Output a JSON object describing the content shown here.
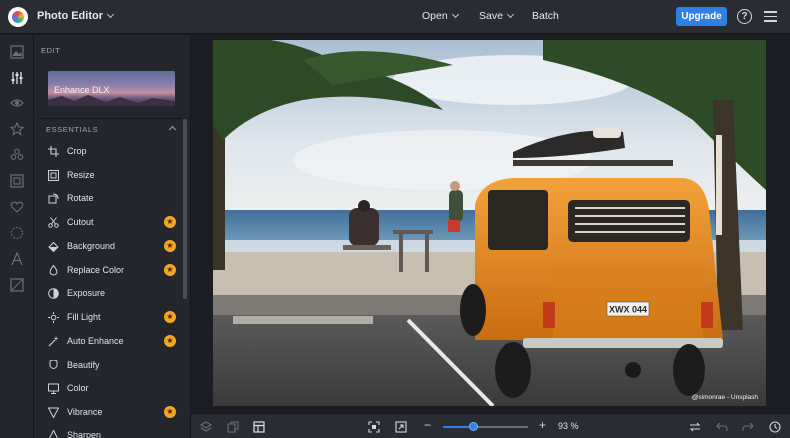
{
  "header": {
    "app_menu": "Photo Editor",
    "nav": [
      "Open",
      "Save",
      "Batch"
    ],
    "upgrade": "Upgrade",
    "help_glyph": "?"
  },
  "rail": {
    "icons": [
      "image-icon",
      "sliders-icon",
      "eye-icon",
      "star-icon",
      "brush-icon",
      "frame-icon",
      "heart-icon",
      "texture-icon",
      "text-icon",
      "graphics-icon"
    ],
    "active": "sliders-icon"
  },
  "panel": {
    "title": "EDIT",
    "dlx_label": "Enhance DLX",
    "section": "ESSENTIALS",
    "tools": [
      {
        "label": "Crop",
        "premium": false,
        "icon": "crop-icon"
      },
      {
        "label": "Resize",
        "premium": false,
        "icon": "resize-icon"
      },
      {
        "label": "Rotate",
        "premium": false,
        "icon": "rotate-icon"
      },
      {
        "label": "Cutout",
        "premium": true,
        "icon": "scissors-icon"
      },
      {
        "label": "Background",
        "premium": true,
        "icon": "eraser-icon"
      },
      {
        "label": "Replace Color",
        "premium": true,
        "icon": "droplet-icon"
      },
      {
        "label": "Exposure",
        "premium": false,
        "icon": "exposure-icon"
      },
      {
        "label": "Fill Light",
        "premium": true,
        "icon": "bulb-icon"
      },
      {
        "label": "Auto Enhance",
        "premium": true,
        "icon": "wand-icon"
      },
      {
        "label": "Beautify",
        "premium": false,
        "icon": "face-icon"
      },
      {
        "label": "Color",
        "premium": false,
        "icon": "palette-icon"
      },
      {
        "label": "Vibrance",
        "premium": true,
        "icon": "triangle-icon"
      },
      {
        "label": "Sharpen",
        "premium": false,
        "icon": "sharpen-icon"
      }
    ],
    "premium_glyph": "★"
  },
  "photo": {
    "credit": "@simonrae - Unsplash",
    "plate": "XWX 044"
  },
  "bottom": {
    "zoom_value": "93 %",
    "zoom_level": 0.35,
    "minus": "−",
    "plus": "+"
  },
  "colors": {
    "accent": "#2f80e6",
    "premium": "#f5a524",
    "van": "#e8891c"
  }
}
